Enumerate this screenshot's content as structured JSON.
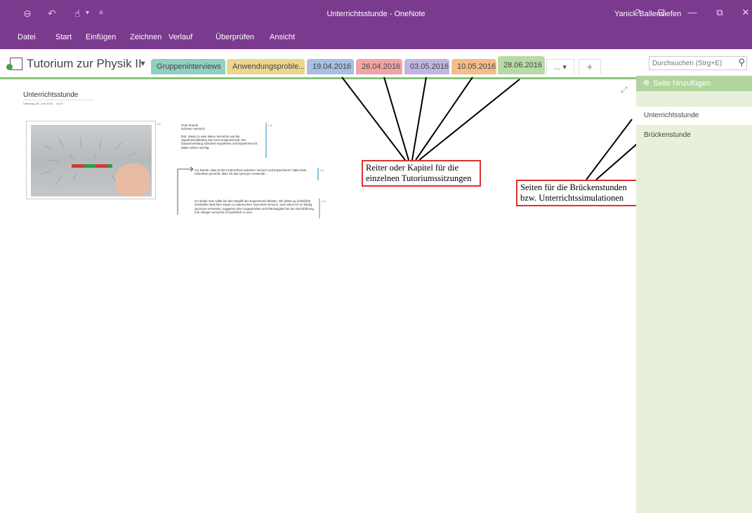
{
  "window": {
    "title": "Unterrichtsstunde  - OneNote",
    "user": "Yanick Ballensiefen",
    "buttons": {
      "help": "?",
      "display": "⊡",
      "minimize": "—",
      "restore": "⧉",
      "close": "✕"
    }
  },
  "quick_access": {
    "back": "⊖",
    "undo": "↶",
    "touch": "☝",
    "touch_caret": "▾",
    "customize": "≡"
  },
  "ribbon": {
    "tabs": [
      "Datei",
      "Start",
      "Einfügen",
      "Zeichnen",
      "Verlauf",
      "Überprüfen",
      "Ansicht"
    ]
  },
  "notebook": {
    "name": "Tutorium zur Physik II",
    "caret": "▼",
    "sections": [
      {
        "label": "Gruppeninterviews",
        "color": "#90cfc2"
      },
      {
        "label": "Anwendungsproble...",
        "color": "#ecd58e"
      },
      {
        "label": "19.04.2016",
        "color": "#a7bfe0"
      },
      {
        "label": "26.04.2016",
        "color": "#f0a5a5"
      },
      {
        "label": "03.05.2016",
        "color": "#c0b6e2"
      },
      {
        "label": "10.05.2016",
        "color": "#f4bd8a"
      },
      {
        "label": "28.06.2016",
        "color": "#b7dba5"
      }
    ],
    "more_tabs": "...  ▾",
    "add_tab": "+"
  },
  "search": {
    "placeholder": "Durchsuchen (Strg+E)",
    "icon": "search-icon"
  },
  "page": {
    "title": "Unterrichtsstunde",
    "date": "Dienstag, 28. Juni 2016",
    "time": "10:27",
    "expand_icon": "⤢",
    "author_tag": "Ldt",
    "notes": [
      "Gute Stunde\nSchöner Versuch!\n\nEvtl. etwas zu viele kleine Versuche und die Hypothesenbildung war recht anspruchsvoll. Der Zusammenhang zwischen Hypothese und Experiment ist dabei extrem wichtig.",
      "Am Rande: Was ist der Unterschied zwischen Versuch und Experiment? Habe beim Schreiben gemerkt, dass ich das synonym verwende...",
      "Ich denke man sollte bei dem Begriff des Experiments bleiben. Wir haben ja schließlich ernsthafte Absichten etwas zu untersuchen. Das Wort Versuch, auch wenn ich es häufig synonym verwende, suggeriert eine Ungewissheit und Planlosigkeit bei der Durchführung. Z.B. Morgen versuche ich pünktlich zu sein."
    ]
  },
  "annotations": {
    "sections_callout": "Reiter oder Kapitel für die\neinzelnen Tutoriumssitzungen",
    "pages_callout": "Seiten für die Brückenstunden\nbzw. Unterrichtssimulationen"
  },
  "pages_pane": {
    "add_page": "Seite hinzufügen",
    "add_icon": "⊕",
    "pages": [
      "Unterrichtsstunde",
      "Brückenstunde"
    ]
  },
  "colors": {
    "brand": "#7a3a8e",
    "pane_bg": "#e6f0da",
    "pane_header": "#b2d49d",
    "callout_border": "#e03030"
  }
}
